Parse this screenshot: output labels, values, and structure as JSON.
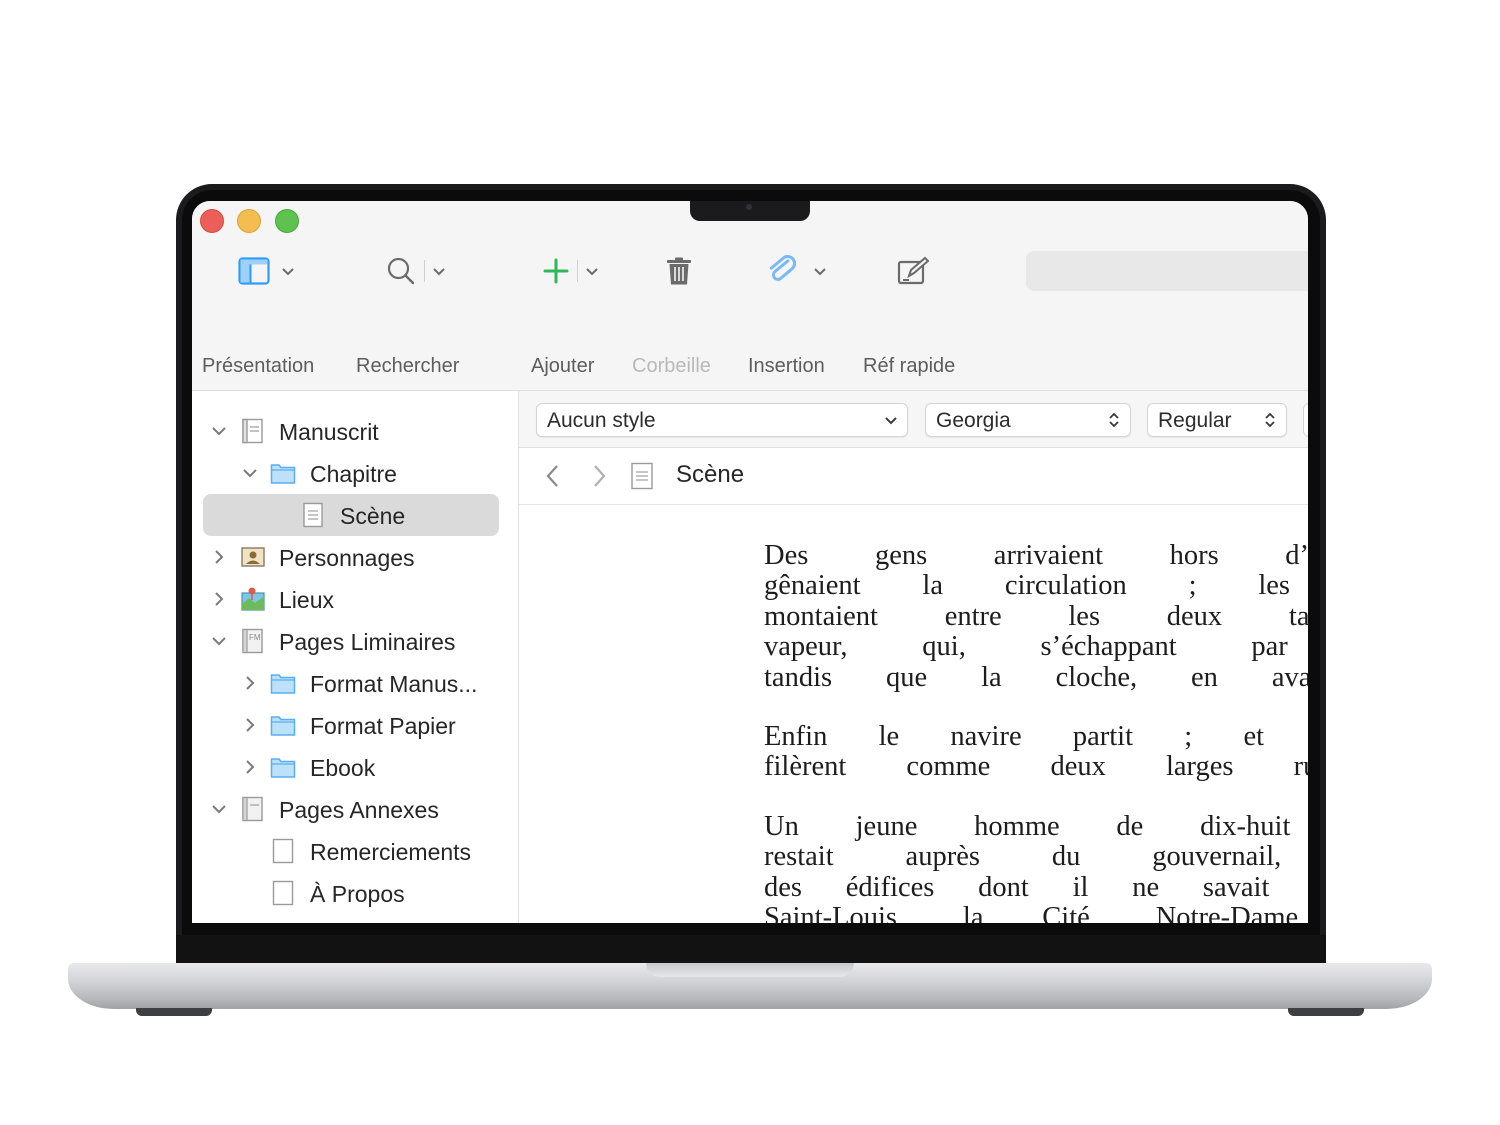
{
  "window": {
    "controls": [
      "close",
      "minimize",
      "zoom"
    ]
  },
  "toolbar": {
    "presentation_label": "Présentation",
    "search_label": "Rechercher",
    "add_label": "Ajouter",
    "trash_label": "Corbeille",
    "insertion_label": "Insertion",
    "quickref_label": "Réf rapide",
    "icons": {
      "presentation": "sidebar-layout-icon",
      "search": "magnifier-icon",
      "add": "plus-icon",
      "trash": "trash-icon",
      "insertion": "paperclip-icon",
      "quickref": "compose-icon"
    },
    "accent_color": "#2f9cf4",
    "add_color": "#2fb85a"
  },
  "binder": {
    "items": [
      {
        "label": "Manuscrit",
        "icon": "draft-folder-icon",
        "expanded": true
      },
      {
        "label": "Chapitre",
        "icon": "folder-icon",
        "expanded": true
      },
      {
        "label": "Scène",
        "icon": "document-icon",
        "selected": true
      },
      {
        "label": "Personnages",
        "icon": "character-icon",
        "expanded": false
      },
      {
        "label": "Lieux",
        "icon": "places-icon",
        "expanded": false
      },
      {
        "label": "Pages Liminaires",
        "icon": "front-matter-icon",
        "expanded": true
      },
      {
        "label": "Format Manus...",
        "icon": "folder-icon",
        "expanded": false
      },
      {
        "label": "Format Papier",
        "icon": "folder-icon",
        "expanded": false
      },
      {
        "label": "Ebook",
        "icon": "folder-icon",
        "expanded": false
      },
      {
        "label": "Pages Annexes",
        "icon": "back-matter-icon",
        "expanded": true
      },
      {
        "label": "Remerciements",
        "icon": "blank-page-icon"
      },
      {
        "label": "À Propos",
        "icon": "blank-page-icon"
      }
    ]
  },
  "format_bar": {
    "style_value": "Aucun style",
    "font_value": "Georgia",
    "weight_value": "Regular"
  },
  "editor": {
    "title": "Scène",
    "paragraphs": [
      [
        "Des gens arrivaient hors d’haleine ; des ba",
        "gênaient la circulation ; les matelots ne répon",
        "montaient entre les deux tambours, et le ta",
        "vapeur, qui, s’échappant par des plaques de",
        "tandis que la cloche, en avant, tintait sans disc"
      ],
      [
        "Enfin le navire partit ; et les deux berges, pe",
        "filèrent comme deux larges rubans que l’on dé"
      ],
      [
        "Un jeune homme de dix-huit ans, à longs ch",
        "restait auprès du gouvernail, immobile. À tra",
        "des édifices dont il ne savait pas les noms ; pui",
        "Saint-Louis, la Cité, Notre-Dame ; et bientôt, P"
      ]
    ]
  }
}
